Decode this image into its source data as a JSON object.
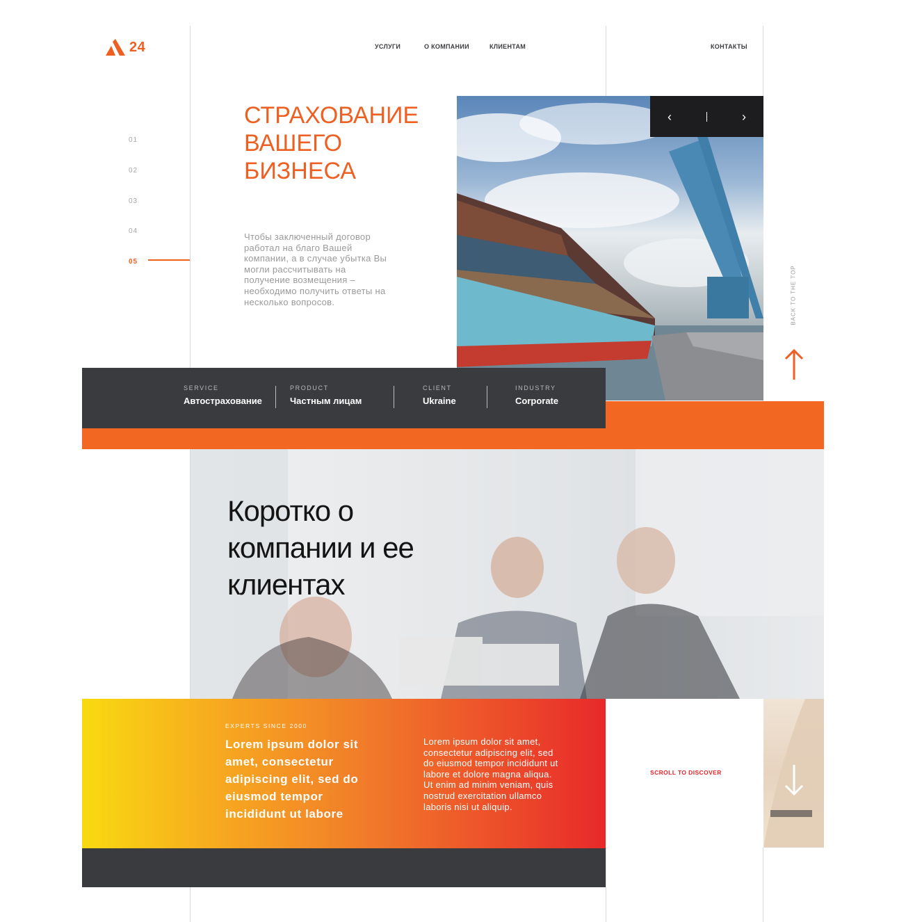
{
  "logo": {
    "text": "24"
  },
  "nav": {
    "items": [
      "УСЛУГИ",
      "О КОМПАНИИ",
      "КЛИЕНТАМ"
    ],
    "contacts": "КОНТАКТЫ"
  },
  "side_nav": {
    "items": [
      "01",
      "02",
      "03",
      "04",
      "05"
    ],
    "active": "05"
  },
  "hero": {
    "title": "СТРАХОВАНИЕ ВАШЕГО БИЗНЕСА",
    "text": "Чтобы заключенный договор работал на благо Вашей компании, а в случае убытка Вы могли рассчитывать на получение возмещения – необходимо получить ответы на несколько вопросов."
  },
  "slider": {
    "prev": "‹",
    "next": "›"
  },
  "back_to_top": "BACK TO THE TOP",
  "info_bar": {
    "columns": [
      {
        "label": "SERVICE",
        "value": "Автострахование"
      },
      {
        "label": "PRODUCT",
        "value": "Частным лицам"
      },
      {
        "label": "CLIENT",
        "value": "Ukraine"
      },
      {
        "label": "INDUSTRY",
        "value": "Corporate"
      }
    ]
  },
  "about": {
    "title": "Коротко о компании и ее клиентах"
  },
  "experts": {
    "label": "EXPERTS SINCE 2000",
    "heading": "Lorem ipsum dolor sit amet, consectetur adipiscing elit, sed do eiusmod tempor incididunt ut labore",
    "text": "Lorem ipsum dolor sit amet, consectetur adipiscing elit, sed do eiusmod tempor incididunt ut labore et dolore magna aliqua. Ut enim ad minim veniam, quis nostrud exercitation ullamco laboris nisi ut aliquip."
  },
  "scroll_to_discover": "SCROLL TO DISCOVER",
  "colors": {
    "accent": "#ee5f22",
    "orange_band": "#f26722",
    "dark": "#3a3b3f",
    "red": "#e6242b",
    "yellow": "#f8da10"
  }
}
